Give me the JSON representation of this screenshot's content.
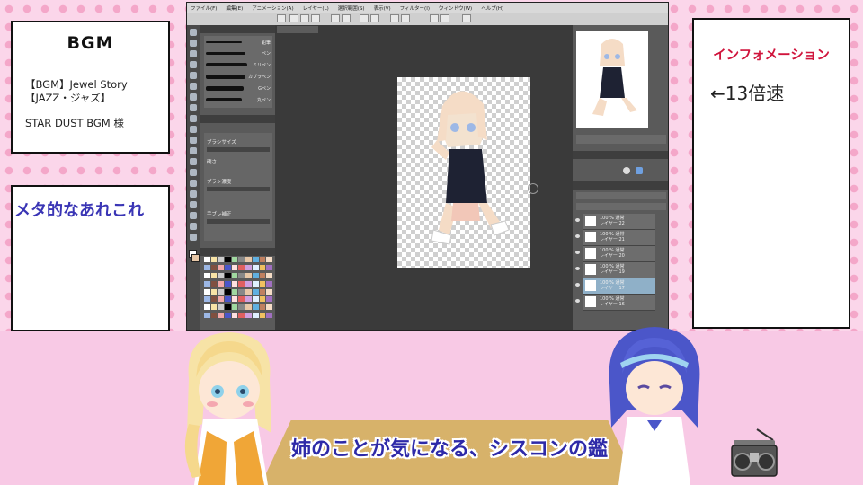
{
  "bgm": {
    "title": "BGM",
    "line1": "【BGM】Jewel Story",
    "line2": "【JAZZ・ジャズ】",
    "credit": "STAR DUST BGM 様"
  },
  "meta": {
    "title": "メタ的なあれこれ"
  },
  "info": {
    "title": "インフォメーション",
    "body": "←13倍速"
  },
  "subtitle": "姉のことが気になる、シスコンの鑑",
  "app": {
    "menu": [
      "ファイル(F)",
      "編集(E)",
      "アニメーション(A)",
      "レイヤー(L)",
      "選択範囲(S)",
      "表示(V)",
      "フィルター(I)",
      "ウィンドウ(W)",
      "ヘルプ(H)"
    ],
    "brushes": [
      "鉛筆",
      "ペン",
      "ミリペン",
      "カブラペン",
      "Gペン",
      "丸ペン"
    ],
    "props": [
      "ブラシサイズ",
      "硬さ",
      "ブラシ濃度",
      "手ブレ補正"
    ],
    "layers": [
      {
        "label": "100 % 通常\nレイヤー 22"
      },
      {
        "label": "100 % 通常\nレイヤー 21"
      },
      {
        "label": "100 % 通常\nレイヤー 20"
      },
      {
        "label": "100 % 通常\nレイヤー 19"
      },
      {
        "label": "100 % 通常\nレイヤー 17"
      },
      {
        "label": "100 % 通常\nレイヤー 16"
      }
    ]
  }
}
